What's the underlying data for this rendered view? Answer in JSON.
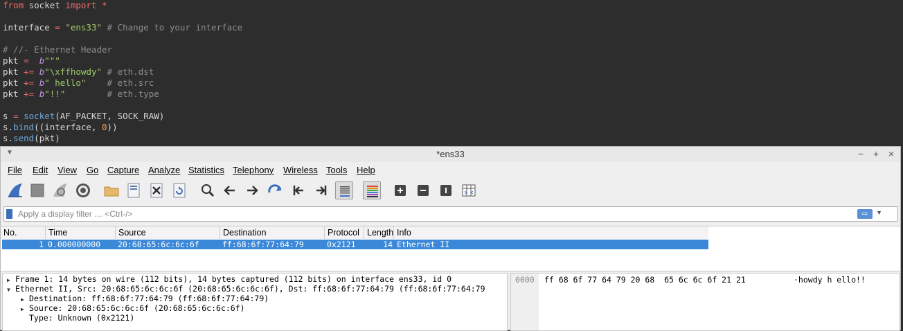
{
  "editor": {
    "lines": [
      {
        "segments": [
          {
            "t": "from",
            "c": "kw"
          },
          {
            "t": " socket ",
            "c": "plain"
          },
          {
            "t": "import",
            "c": "kw"
          },
          {
            "t": " ",
            "c": "plain"
          },
          {
            "t": "*",
            "c": "op"
          }
        ]
      },
      {
        "segments": []
      },
      {
        "segments": [
          {
            "t": "interface ",
            "c": "plain"
          },
          {
            "t": "=",
            "c": "op"
          },
          {
            "t": " ",
            "c": "plain"
          },
          {
            "t": "\"ens33\"",
            "c": "str"
          },
          {
            "t": " # Change to your interface",
            "c": "cm"
          }
        ]
      },
      {
        "segments": []
      },
      {
        "segments": [
          {
            "t": "# //- Ethernet Header",
            "c": "cm"
          }
        ]
      },
      {
        "segments": [
          {
            "t": "pkt ",
            "c": "plain"
          },
          {
            "t": "=",
            "c": "op"
          },
          {
            "t": "  ",
            "c": "plain"
          },
          {
            "t": "b",
            "c": "bt"
          },
          {
            "t": "\"\"\"",
            "c": "str"
          }
        ]
      },
      {
        "segments": [
          {
            "t": "pkt ",
            "c": "plain"
          },
          {
            "t": "+=",
            "c": "op"
          },
          {
            "t": " ",
            "c": "plain"
          },
          {
            "t": "b",
            "c": "bt"
          },
          {
            "t": "\"\\xffhowdy\"",
            "c": "str"
          },
          {
            "t": " # eth.dst",
            "c": "cm"
          }
        ]
      },
      {
        "segments": [
          {
            "t": "pkt ",
            "c": "plain"
          },
          {
            "t": "+=",
            "c": "op"
          },
          {
            "t": " ",
            "c": "plain"
          },
          {
            "t": "b",
            "c": "bt"
          },
          {
            "t": "\" hello\"",
            "c": "str"
          },
          {
            "t": "    # eth.src",
            "c": "cm"
          }
        ]
      },
      {
        "segments": [
          {
            "t": "pkt ",
            "c": "plain"
          },
          {
            "t": "+=",
            "c": "op"
          },
          {
            "t": " ",
            "c": "plain"
          },
          {
            "t": "b",
            "c": "bt"
          },
          {
            "t": "\"!!\"",
            "c": "str"
          },
          {
            "t": "        # eth.type",
            "c": "cm"
          }
        ]
      },
      {
        "segments": []
      },
      {
        "segments": [
          {
            "t": "s ",
            "c": "plain"
          },
          {
            "t": "=",
            "c": "op"
          },
          {
            "t": " ",
            "c": "plain"
          },
          {
            "t": "socket",
            "c": "fn"
          },
          {
            "t": "(AF_PACKET, SOCK_RAW)",
            "c": "plain"
          }
        ]
      },
      {
        "segments": [
          {
            "t": "s.",
            "c": "plain"
          },
          {
            "t": "bind",
            "c": "fn"
          },
          {
            "t": "((interface, ",
            "c": "plain"
          },
          {
            "t": "0",
            "c": "num"
          },
          {
            "t": "))",
            "c": "plain"
          }
        ]
      },
      {
        "segments": [
          {
            "t": "s.",
            "c": "plain"
          },
          {
            "t": "send",
            "c": "fn"
          },
          {
            "t": "(pkt)",
            "c": "plain"
          }
        ]
      }
    ]
  },
  "window": {
    "title": "*ens33",
    "controls": {
      "minimize": "−",
      "maximize": "+",
      "close": "×"
    }
  },
  "menu": [
    "File",
    "Edit",
    "View",
    "Go",
    "Capture",
    "Analyze",
    "Statistics",
    "Telephony",
    "Wireless",
    "Tools",
    "Help"
  ],
  "toolbar": {
    "icons": [
      "shark-fin-start-icon",
      "stop-square-icon",
      "restart-fin-icon",
      "capture-options-gear-icon",
      "open-folder-icon",
      "save-file-icon",
      "close-file-icon",
      "reload-icon",
      "find-magnifier-icon",
      "go-back-arrow-icon",
      "go-forward-arrow-icon",
      "go-to-packet-icon",
      "first-packet-icon",
      "last-packet-icon",
      "autoscroll-icon",
      "colorize-icon",
      "zoom-in-icon",
      "zoom-out-icon",
      "normal-size-icon",
      "resize-columns-icon"
    ]
  },
  "filter": {
    "placeholder": "Apply a display filter … <Ctrl-/>",
    "apply_symbol": "⇨"
  },
  "packet_list": {
    "columns": [
      "No.",
      "Time",
      "Source",
      "Destination",
      "Protocol",
      "Length",
      "Info"
    ],
    "rows": [
      {
        "no": "1",
        "time": "0.000000000",
        "source": "20:68:65:6c:6c:6f",
        "destination": "ff:68:6f:77:64:79",
        "protocol": "0x2121",
        "length": "14",
        "info": "Ethernet II"
      }
    ]
  },
  "details": {
    "lines": [
      {
        "toggle": "▶",
        "text": "Frame 1: 14 bytes on wire (112 bits), 14 bytes captured (112 bits) on interface ens33, id 0"
      },
      {
        "toggle": "▼",
        "text": "Ethernet II, Src: 20:68:65:6c:6c:6f (20:68:65:6c:6c:6f), Dst: ff:68:6f:77:64:79 (ff:68:6f:77:64:79"
      },
      {
        "toggle": "▶",
        "text": "Destination: ff:68:6f:77:64:79 (ff:68:6f:77:64:79)"
      },
      {
        "toggle": "▶",
        "text": "Source: 20:68:65:6c:6c:6f (20:68:65:6c:6c:6f)"
      },
      {
        "toggle": "",
        "text": "Type: Unknown (0x2121)"
      }
    ]
  },
  "bytes": {
    "offset": "0000",
    "hex": "ff 68 6f 77 64 79 20 68  65 6c 6c 6f 21 21",
    "ascii": "·howdy h ello!!"
  },
  "colors": {
    "editor_bg": "#2d2d2d",
    "selection": "#3b88d8",
    "window_bg": "#efefef"
  }
}
